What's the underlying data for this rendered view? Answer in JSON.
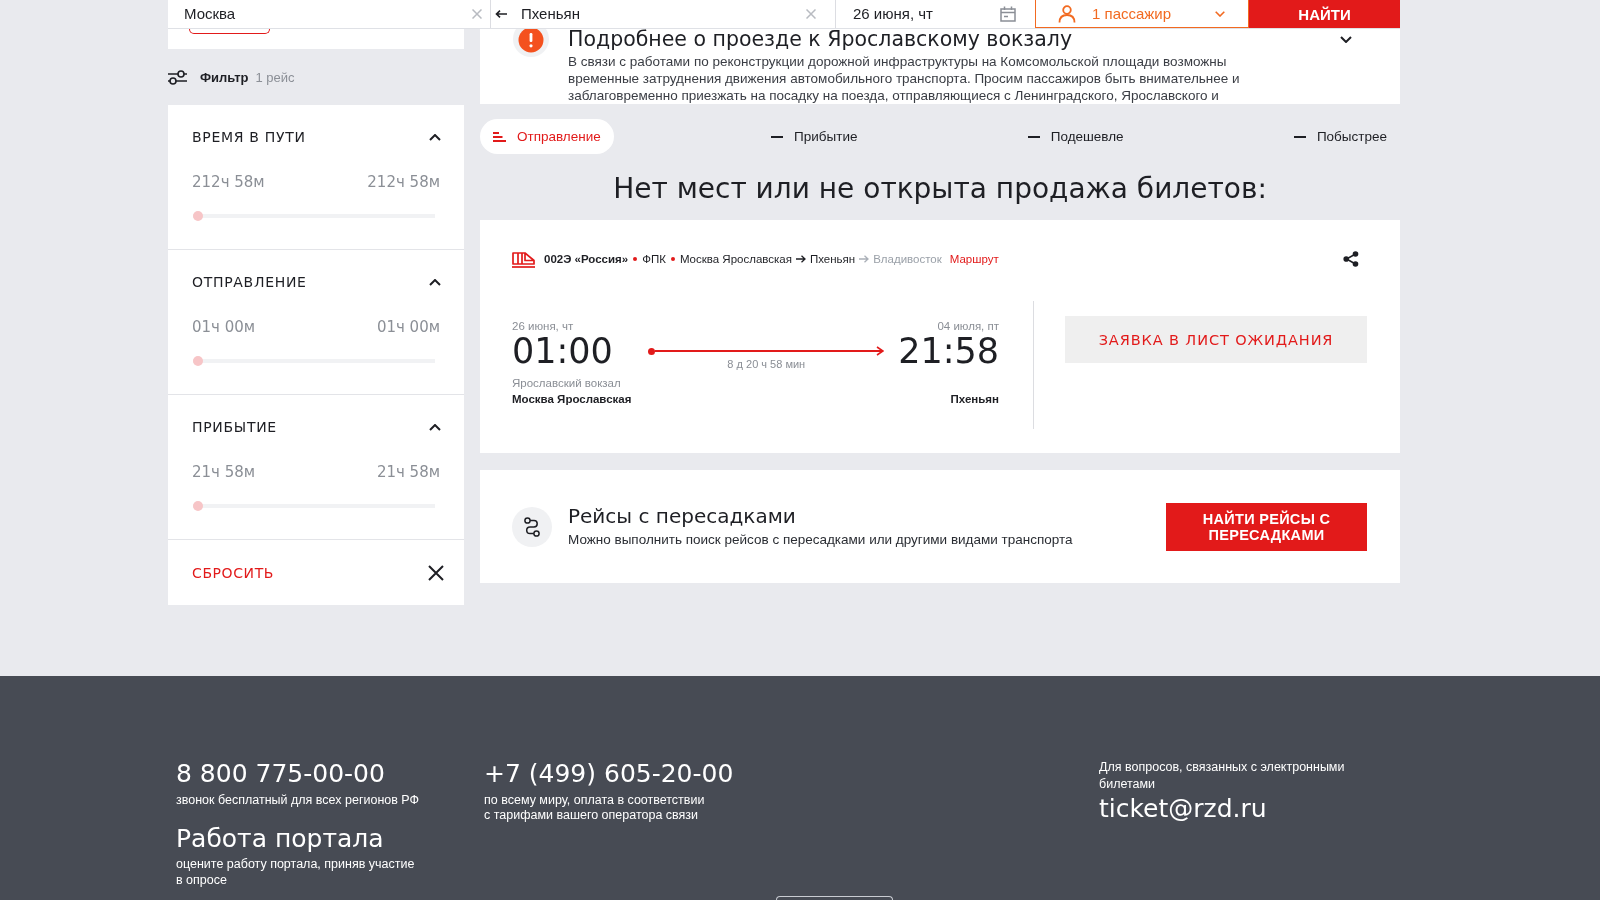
{
  "search_bar": {
    "from_field": {
      "value": "Москва",
      "active": false
    },
    "to_field": {
      "value": "Пхеньян",
      "active": false
    },
    "date_field": {
      "value": "26 июня, чт",
      "active": false
    },
    "passengers_field": {
      "value": "1 пассажир",
      "active": true
    },
    "search_button": "НАЙТИ"
  },
  "filter": {
    "label": "Фильтр",
    "count": "1 рейс",
    "sections": [
      {
        "title": "ВРЕМЯ В ПУТИ",
        "expanded": true,
        "min": "212ч 58м",
        "max": "212ч 58м",
        "level": 0,
        "disabled": true
      },
      {
        "title": "ОТПРАВЛЕНИЕ",
        "expanded": true,
        "min": "01ч 00м",
        "max": "01ч 00м",
        "level": 0,
        "disabled": true
      },
      {
        "title": "ПРИБЫТИЕ",
        "expanded": true,
        "min": "21ч 58м",
        "max": "21ч 58м",
        "level": 0,
        "disabled": true
      }
    ],
    "reset": "СБРОСИТЬ"
  },
  "notice": {
    "title": "Подробнее о проезде к Ярославскому вокзалу",
    "text": "В связи с работами по реконструкции дорожной инфраструктуры на Комсомольской площади возможны временные затруднения движения автомобильного транспорта. Просим пассажиров быть внимательнее и заблаговременно приезжать на посадку на поезда, отправляющиеся с Ленинградского, Ярославского и",
    "expanded": false
  },
  "sort_tabs": [
    {
      "label": "Отправление",
      "selected": true
    },
    {
      "label": "Прибытие",
      "selected": false
    },
    {
      "label": "Подешевле",
      "selected": false
    },
    {
      "label": "Побыстрее",
      "selected": false
    }
  ],
  "heading": "Нет мест или не открыта продажа билетов:",
  "train": {
    "number": "002Э «Россия»",
    "carrier": "ФПК",
    "route": [
      {
        "name": "Москва Ярославская",
        "in_trip": true
      },
      {
        "name": "Пхеньян",
        "in_trip": true
      },
      {
        "name": "Владивосток",
        "in_trip": false
      }
    ],
    "route_link": "Маршрут",
    "departure": {
      "date": "26 июня, чт",
      "time": "01:00",
      "station_note": "Ярославский вокзал",
      "station": "Москва Ярославская"
    },
    "duration": "8 д 20 ч 58 мин",
    "arrival": {
      "date": "04 июля, пт",
      "time": "21:58",
      "station": "Пхеньян"
    },
    "waitlist_button": "ЗАЯВКА В ЛИСТ ОЖИДАНИЯ"
  },
  "transfers": {
    "title": "Рейсы с пересадками",
    "text": "Можно выполнить поиск рейсов с пересадками или другими видами транспорта",
    "button": "НАЙТИ РЕЙСЫ С ПЕРЕСАДКАМИ"
  },
  "footer": {
    "columns": [
      {
        "items": [
          {
            "kind": "phone",
            "title": "8 800 775-00-00",
            "note": "звонок бесплатный для всех регионов РФ"
          },
          {
            "kind": "link",
            "title": "Работа портала",
            "note": "оцените работу портала, приняв участие в опросе"
          }
        ]
      },
      {
        "items": [
          {
            "kind": "phone",
            "title": "+7 (499) 605-20-00",
            "note": "по всему миру, оплата в соответствии с тарифами вашего оператора связи"
          }
        ]
      },
      {
        "items": [
          {
            "kind": "email",
            "title": "ticket@rzd.ru",
            "note": "Для вопросов, связанных с электронными билетами"
          }
        ]
      }
    ]
  }
}
